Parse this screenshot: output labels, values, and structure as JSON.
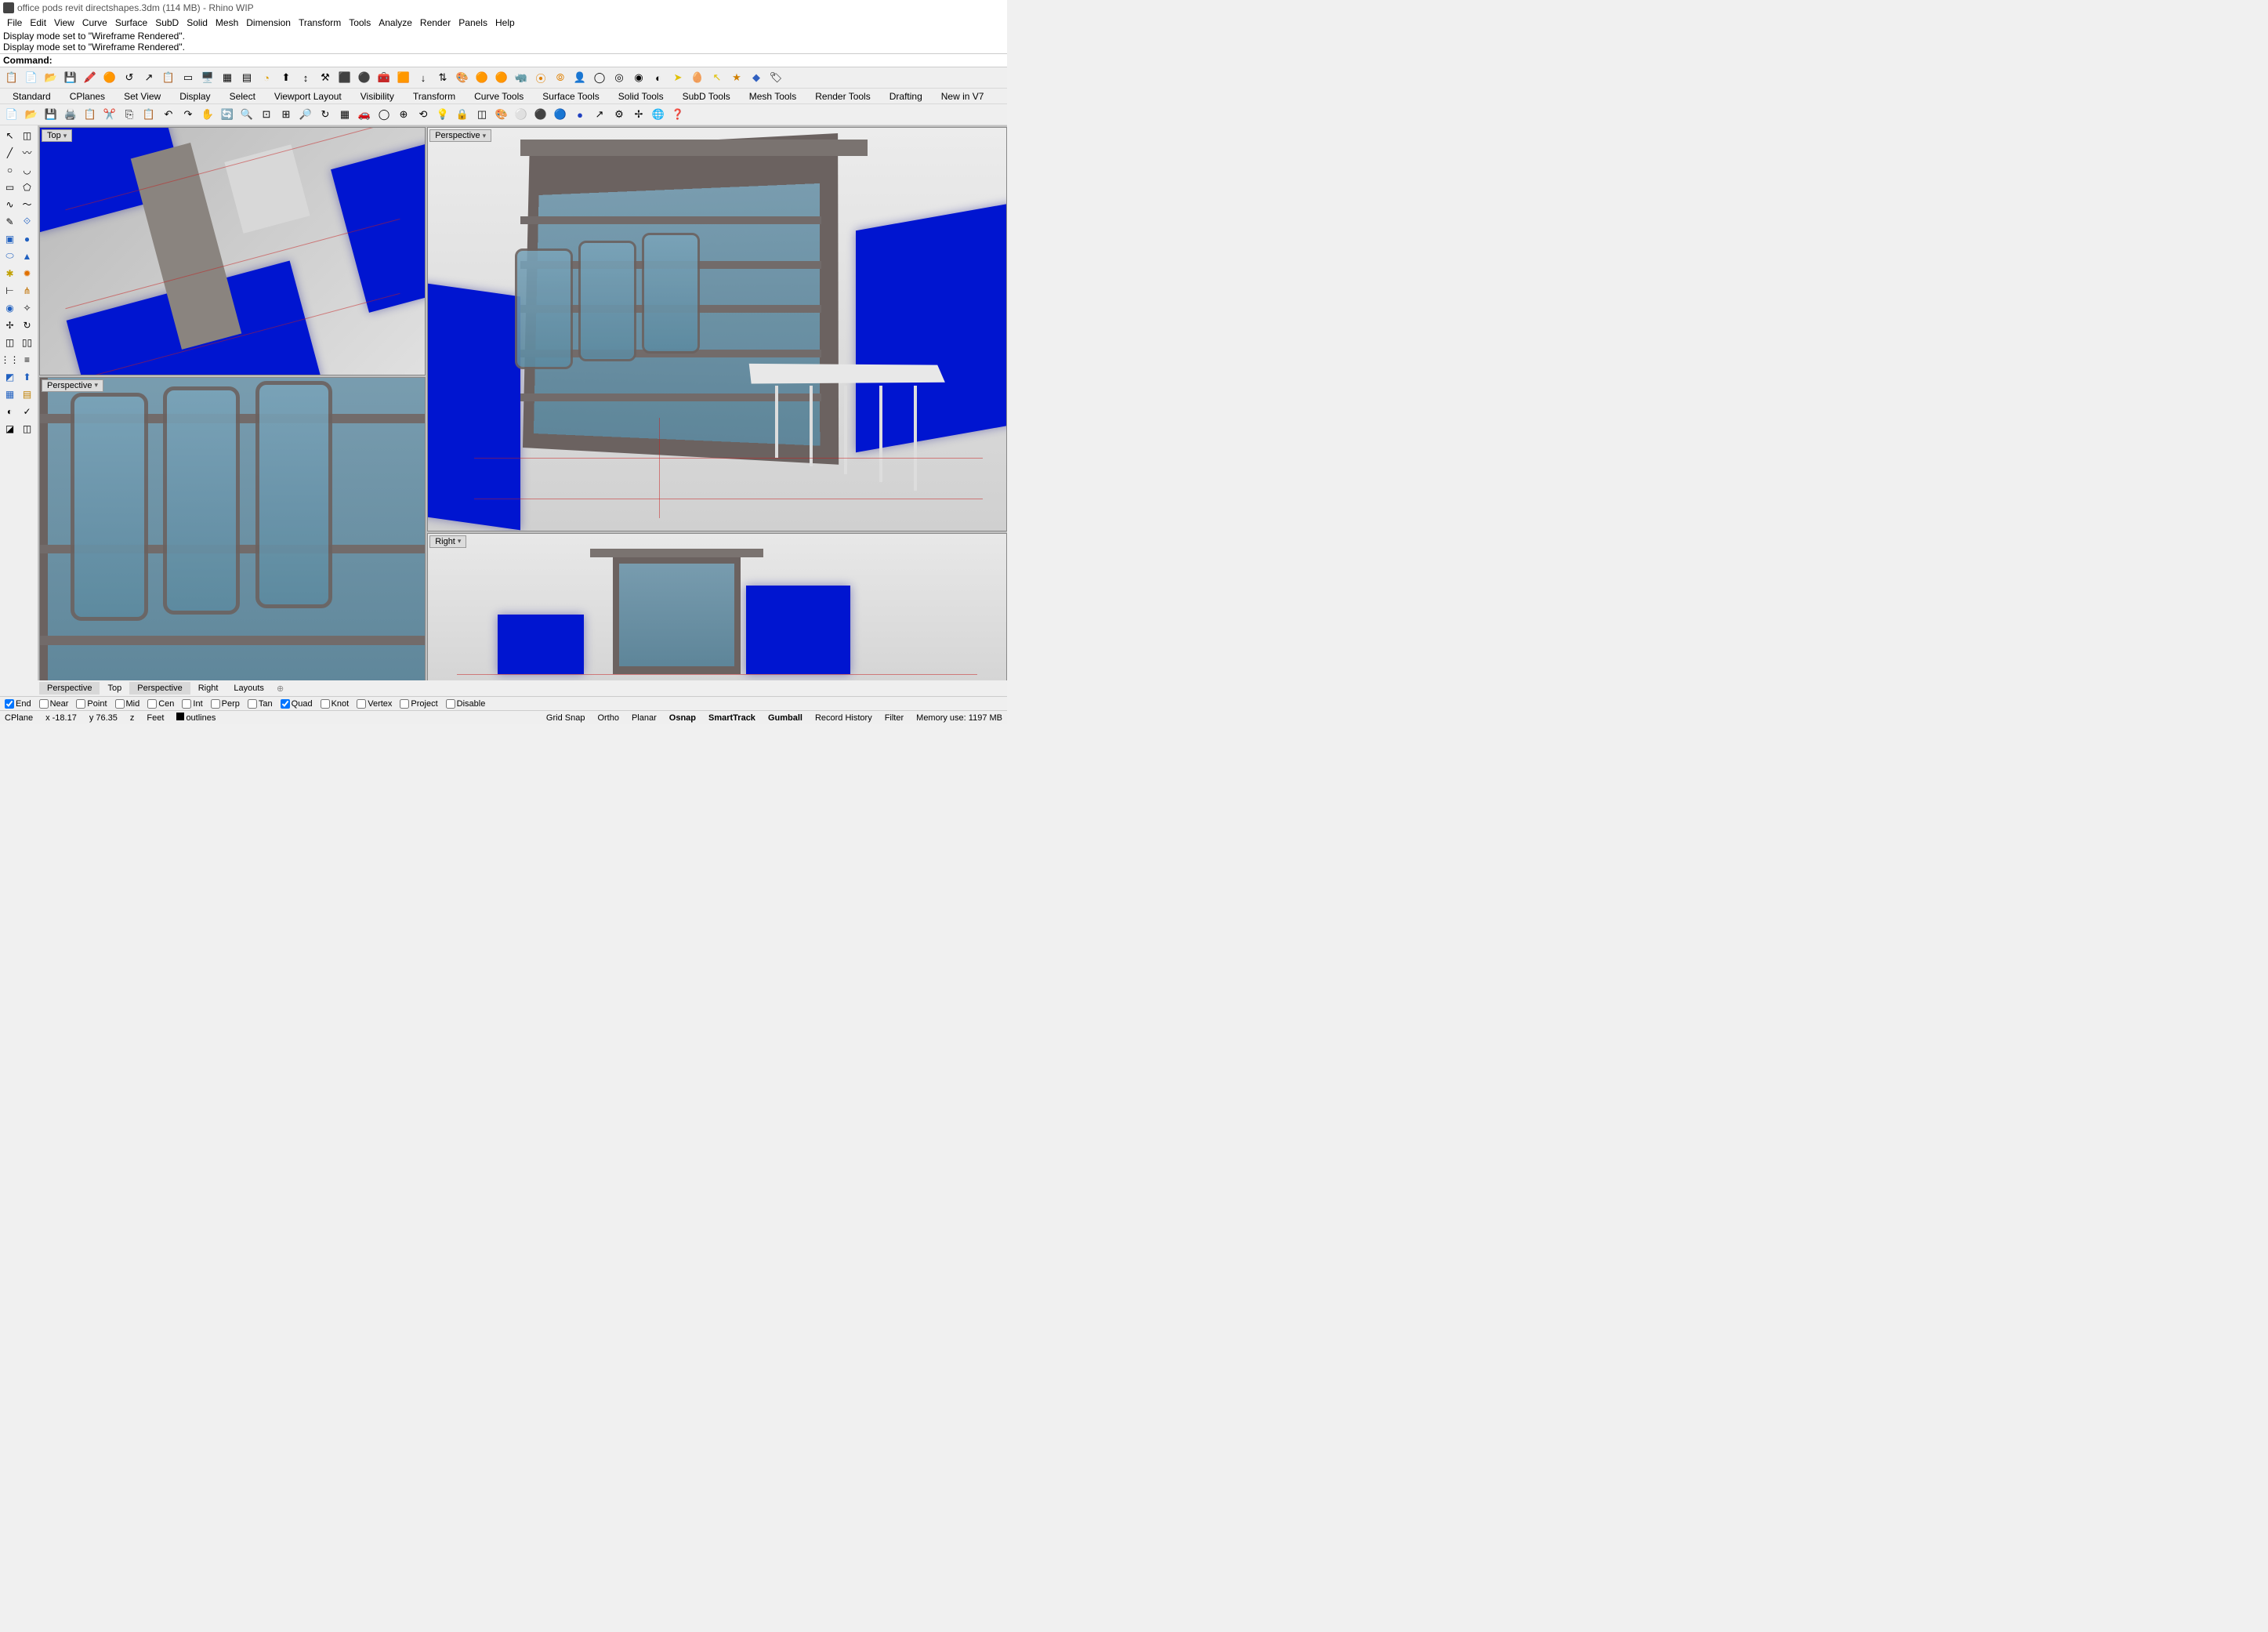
{
  "title": "office pods revit directshapes.3dm (114 MB) - Rhino WIP",
  "menu": [
    "File",
    "Edit",
    "View",
    "Curve",
    "Surface",
    "SubD",
    "Solid",
    "Mesh",
    "Dimension",
    "Transform",
    "Tools",
    "Analyze",
    "Render",
    "Panels",
    "Help"
  ],
  "history": [
    "Display mode set to \"Wireframe Rendered\".",
    "Display mode set to \"Wireframe Rendered\"."
  ],
  "command_label": "Command:",
  "top_tabs": [
    "Standard",
    "CPlanes",
    "Set View",
    "Display",
    "Select",
    "Viewport Layout",
    "Visibility",
    "Transform",
    "Curve Tools",
    "Surface Tools",
    "Solid Tools",
    "SubD Tools",
    "Mesh Tools",
    "Render Tools",
    "Drafting",
    "New in V7"
  ],
  "viewport_labels": {
    "vp1": "Top",
    "vp2": "Perspective",
    "vp3": "Perspective",
    "vp4": "Right"
  },
  "vp_bottom_tabs": [
    "Perspective",
    "Top",
    "Perspective",
    "Right",
    "Layouts"
  ],
  "vp_bottom_active": [
    0,
    2
  ],
  "osnaps": [
    {
      "label": "End",
      "checked": true
    },
    {
      "label": "Near",
      "checked": false
    },
    {
      "label": "Point",
      "checked": false
    },
    {
      "label": "Mid",
      "checked": false
    },
    {
      "label": "Cen",
      "checked": false
    },
    {
      "label": "Int",
      "checked": false
    },
    {
      "label": "Perp",
      "checked": false
    },
    {
      "label": "Tan",
      "checked": false
    },
    {
      "label": "Quad",
      "checked": true
    },
    {
      "label": "Knot",
      "checked": false
    },
    {
      "label": "Vertex",
      "checked": false
    },
    {
      "label": "Project",
      "checked": false
    },
    {
      "label": "Disable",
      "checked": false
    }
  ],
  "status": {
    "cplane": "CPlane",
    "x": "x -18.17",
    "y": "y 76.35",
    "z": "z",
    "units": "Feet",
    "layer": "outlines",
    "gridsnap": "Grid Snap",
    "ortho": "Ortho",
    "planar": "Planar",
    "osnap": "Osnap",
    "smarttrack": "SmartTrack",
    "gumball": "Gumball",
    "record": "Record History",
    "filter": "Filter",
    "mem": "Memory use: 1197 MB"
  }
}
